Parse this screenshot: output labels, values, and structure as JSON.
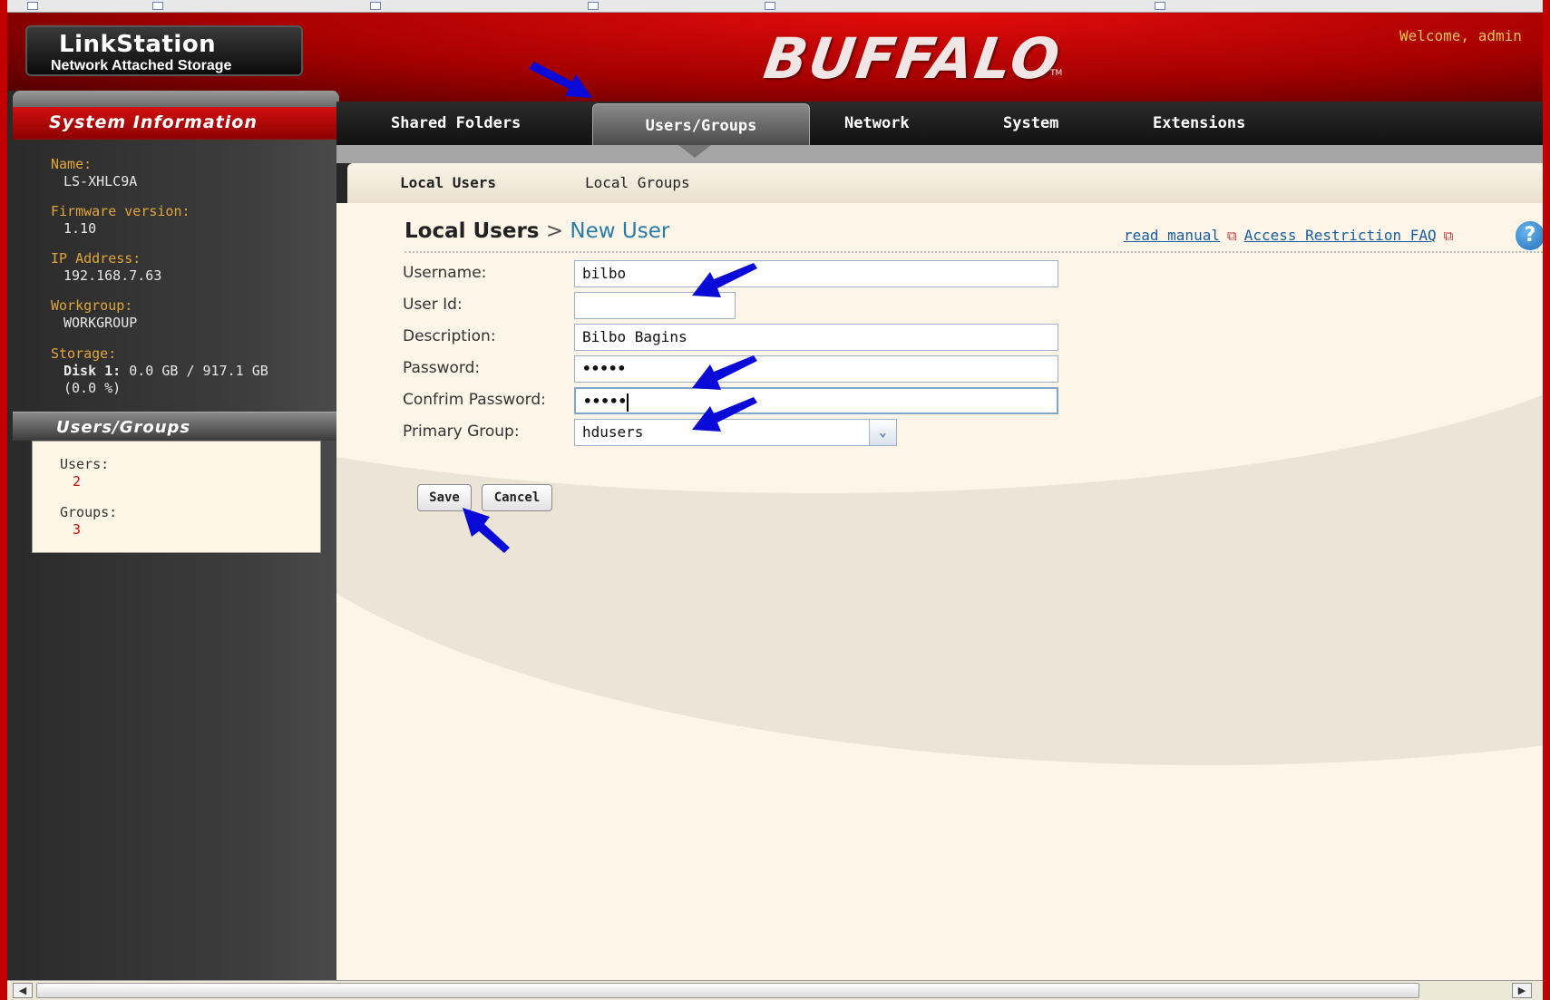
{
  "header": {
    "logo_title": "LinkStation",
    "logo_subtitle": "Network Attached Storage",
    "brand": "BUFFALO",
    "brand_tm": "TM",
    "welcome": "Welcome, admin"
  },
  "sidebar": {
    "system_info_title": "System Information",
    "items": [
      {
        "label": "Name:",
        "value": "LS-XHLC9A"
      },
      {
        "label": "Firmware version:",
        "value": "1.10"
      },
      {
        "label": "IP Address:",
        "value": "192.168.7.63"
      },
      {
        "label": "Workgroup:",
        "value": "WORKGROUP"
      },
      {
        "label": "Storage:",
        "value_bold": "Disk 1:",
        "value": " 0.0 GB / 917.1 GB",
        "value2": "(0.0 %)"
      }
    ],
    "users_groups_title": "Users/Groups",
    "users_label": "Users:",
    "users_count": "2",
    "groups_label": "Groups:",
    "groups_count": "3"
  },
  "nav": {
    "tabs": [
      {
        "label": "Shared Folders"
      },
      {
        "label": "Users/Groups"
      },
      {
        "label": "Network"
      },
      {
        "label": "System"
      },
      {
        "label": "Extensions"
      }
    ],
    "active_tab": "Users/Groups"
  },
  "subnav": {
    "tabs": [
      {
        "label": "Local Users"
      },
      {
        "label": "Local Groups"
      }
    ],
    "active_tab": "Local Users"
  },
  "main": {
    "breadcrumb_root": "Local Users",
    "breadcrumb_sep": ">",
    "breadcrumb_current": "New User",
    "read_manual": "read manual",
    "access_faq": "Access Restriction FAQ",
    "help_icon": "?",
    "form": {
      "username_label": "Username:",
      "username_value": "bilbo",
      "userid_label": "User Id:",
      "userid_value": "",
      "description_label": "Description:",
      "description_value": "Bilbo Bagins",
      "password_label": "Password:",
      "password_value": "•••••",
      "confirm_label": "Confrim Password:",
      "confirm_value": "•••••",
      "primary_group_label": "Primary Group:",
      "primary_group_value": "hdusers"
    },
    "save_label": "Save",
    "cancel_label": "Cancel"
  },
  "colors": {
    "accent_red": "#c20000",
    "annotation_arrow": "#0a0ad8",
    "link_blue": "#1a5ca0"
  }
}
